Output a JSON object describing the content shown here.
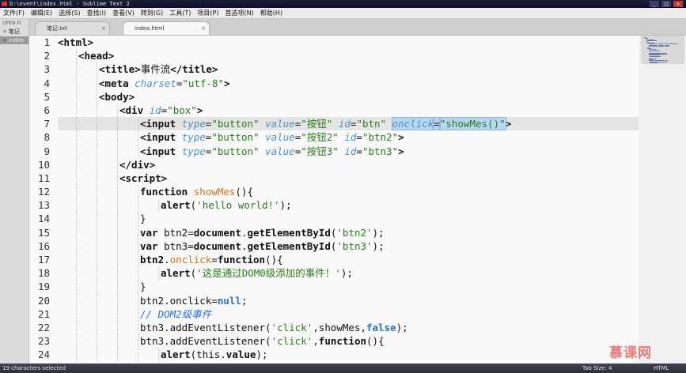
{
  "window": {
    "title": "D:\\event\\index.html - Sublime Text 2"
  },
  "menu": [
    "文件(F)",
    "编辑(E)",
    "选择(S)",
    "查找(I)",
    "查看(V)",
    "转到(G)",
    "工具(T)",
    "项目(P)",
    "首选项(N)",
    "帮助(H)"
  ],
  "sidebar": {
    "header": "OPEN FI",
    "files": [
      {
        "name": "笔记",
        "active": false
      },
      {
        "name": "index",
        "active": true
      }
    ]
  },
  "tabs": [
    {
      "label": "笔记.txt",
      "active": false
    },
    {
      "label": "index.html",
      "active": true
    }
  ],
  "editor": {
    "current_line": 7,
    "lines": [
      {
        "n": 1,
        "indent": 0,
        "tokens": [
          [
            "tg",
            "<html>"
          ]
        ]
      },
      {
        "n": 2,
        "indent": 1,
        "tokens": [
          [
            "tg",
            "<head>"
          ]
        ]
      },
      {
        "n": 3,
        "indent": 2,
        "tokens": [
          [
            "tg",
            "<title>"
          ],
          [
            "",
            "事件流"
          ],
          [
            "tg",
            "</title>"
          ]
        ]
      },
      {
        "n": 4,
        "indent": 2,
        "tokens": [
          [
            "tg",
            "<meta "
          ],
          [
            "at",
            "charset"
          ],
          [
            "",
            "="
          ],
          [
            "st",
            "\"utf-8\""
          ],
          [
            "tg",
            ">"
          ]
        ]
      },
      {
        "n": 5,
        "indent": 2,
        "tokens": [
          [
            "tg",
            "<body>"
          ]
        ]
      },
      {
        "n": 6,
        "indent": 3,
        "tokens": [
          [
            "tg",
            "<div "
          ],
          [
            "at",
            "id"
          ],
          [
            "",
            "="
          ],
          [
            "st",
            "\"box\""
          ],
          [
            "tg",
            ">"
          ]
        ]
      },
      {
        "n": 7,
        "indent": 4,
        "tokens": [
          [
            "tg",
            "<input "
          ],
          [
            "at",
            "type"
          ],
          [
            "",
            "="
          ],
          [
            "st",
            "\"button\""
          ],
          [
            "",
            " "
          ],
          [
            "at",
            "value"
          ],
          [
            "",
            "="
          ],
          [
            "st",
            "\"按钮\""
          ],
          [
            "",
            " "
          ],
          [
            "at",
            "id"
          ],
          [
            "",
            "="
          ],
          [
            "st",
            "\"btn\""
          ],
          [
            "",
            " "
          ],
          [
            "sel_at",
            "onclick"
          ],
          [
            "sel",
            "="
          ],
          [
            "sel_st",
            "\"showMes()\""
          ],
          [
            "tg",
            ">"
          ]
        ]
      },
      {
        "n": 8,
        "indent": 4,
        "tokens": [
          [
            "tg",
            "<input "
          ],
          [
            "at",
            "type"
          ],
          [
            "",
            "="
          ],
          [
            "st",
            "\"button\""
          ],
          [
            "",
            " "
          ],
          [
            "at",
            "value"
          ],
          [
            "",
            "="
          ],
          [
            "st",
            "\"按钮2\""
          ],
          [
            "",
            " "
          ],
          [
            "at",
            "id"
          ],
          [
            "",
            "="
          ],
          [
            "st",
            "\"btn2\""
          ],
          [
            "tg",
            ">"
          ]
        ]
      },
      {
        "n": 9,
        "indent": 4,
        "tokens": [
          [
            "tg",
            "<input "
          ],
          [
            "at",
            "type"
          ],
          [
            "",
            "="
          ],
          [
            "st",
            "\"button\""
          ],
          [
            "",
            " "
          ],
          [
            "at",
            "value"
          ],
          [
            "",
            "="
          ],
          [
            "st",
            "\"按钮3\""
          ],
          [
            "",
            " "
          ],
          [
            "at",
            "id"
          ],
          [
            "",
            "="
          ],
          [
            "st",
            "\"btn3\""
          ],
          [
            "tg",
            ">"
          ]
        ]
      },
      {
        "n": 10,
        "indent": 3,
        "tokens": [
          [
            "tg",
            "</div>"
          ]
        ]
      },
      {
        "n": 11,
        "indent": 3,
        "tokens": [
          [
            "tg",
            "<script>"
          ]
        ]
      },
      {
        "n": 12,
        "indent": 4,
        "tokens": [
          [
            "kw",
            "function "
          ],
          [
            "fn",
            "showMes"
          ],
          [
            "",
            "(){"
          ]
        ]
      },
      {
        "n": 13,
        "indent": 5,
        "tokens": [
          [
            "kw",
            "alert"
          ],
          [
            "",
            "("
          ],
          [
            "st",
            "'hello world!'"
          ],
          [
            "",
            ");"
          ]
        ]
      },
      {
        "n": 14,
        "indent": 4,
        "tokens": [
          [
            "",
            "}"
          ]
        ]
      },
      {
        "n": 15,
        "indent": 4,
        "tokens": [
          [
            "kw",
            "var "
          ],
          [
            "",
            "btn2="
          ],
          [
            "kw",
            "document"
          ],
          [
            "",
            "."
          ],
          [
            "kw",
            "getElementById"
          ],
          [
            "",
            "("
          ],
          [
            "st",
            "'btn2'"
          ],
          [
            "",
            ");"
          ]
        ]
      },
      {
        "n": 16,
        "indent": 4,
        "tokens": [
          [
            "kw",
            "var "
          ],
          [
            "",
            "btn3="
          ],
          [
            "kw",
            "document"
          ],
          [
            "",
            "."
          ],
          [
            "kw",
            "getElementById"
          ],
          [
            "",
            "("
          ],
          [
            "st",
            "'btn3'"
          ],
          [
            "",
            ");"
          ]
        ]
      },
      {
        "n": 17,
        "indent": 4,
        "tokens": [
          [
            "kw",
            "btn2"
          ],
          [
            "",
            "."
          ],
          [
            "fn",
            "onclick"
          ],
          [
            "",
            "="
          ],
          [
            "kw",
            "function"
          ],
          [
            "",
            "(){"
          ]
        ]
      },
      {
        "n": 18,
        "indent": 5,
        "tokens": [
          [
            "kw",
            "alert"
          ],
          [
            "",
            "("
          ],
          [
            "st",
            "'这是通过DOM0级添加的事件！'"
          ],
          [
            "",
            ");"
          ]
        ]
      },
      {
        "n": 19,
        "indent": 4,
        "tokens": [
          [
            "",
            "}"
          ]
        ]
      },
      {
        "n": 20,
        "indent": 4,
        "tokens": [
          [
            "",
            "btn2.onclick="
          ],
          [
            "bl",
            "null"
          ],
          [
            "",
            ";"
          ]
        ]
      },
      {
        "n": 21,
        "indent": 4,
        "tokens": [
          [
            "cm",
            "// DOM2级事件"
          ]
        ]
      },
      {
        "n": 22,
        "indent": 4,
        "tokens": [
          [
            "",
            "btn3.addEventListener("
          ],
          [
            "st",
            "'click'"
          ],
          [
            "",
            ",showMes,"
          ],
          [
            "bl",
            "false"
          ],
          [
            "",
            ");"
          ]
        ]
      },
      {
        "n": 23,
        "indent": 4,
        "tokens": [
          [
            "",
            "btn3.addEventListener("
          ],
          [
            "st",
            "'click'"
          ],
          [
            "",
            ","
          ],
          [
            "kw",
            "function"
          ],
          [
            "",
            "(){"
          ]
        ]
      },
      {
        "n": 24,
        "indent": 5,
        "tokens": [
          [
            "kw",
            "alert"
          ],
          [
            "",
            "(this."
          ],
          [
            "kw",
            "value"
          ],
          [
            "",
            ");"
          ]
        ]
      }
    ]
  },
  "watermark": "慕课网",
  "statusbar": {
    "selection": "19 characters selected",
    "tab_size": "Tab Size: 4",
    "syntax": "HTML"
  }
}
